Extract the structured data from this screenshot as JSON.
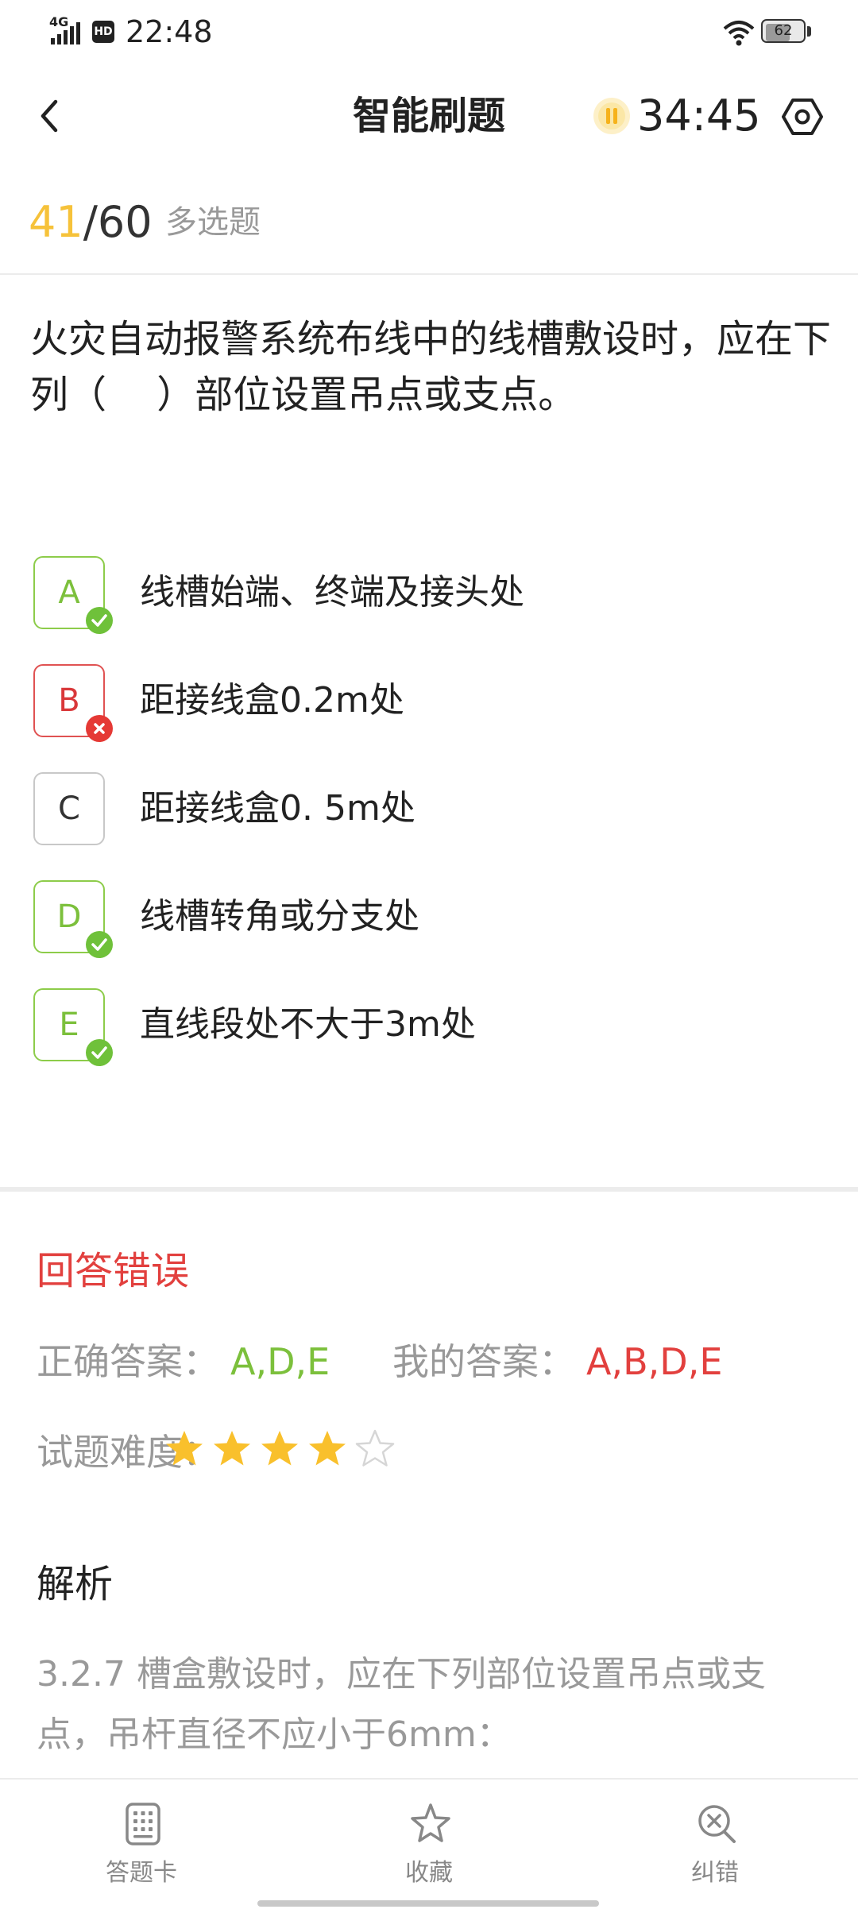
{
  "status_bar": {
    "network": "4G",
    "hd": "HD",
    "time": "22:48",
    "battery": "62"
  },
  "nav": {
    "title": "智能刷题",
    "timer": "34:45"
  },
  "progress": {
    "current": "41",
    "separator": "/",
    "total": "60",
    "type": "多选题"
  },
  "question": {
    "text": "火灾自动报警系统布线中的线槽敷设时，应在下列（　 ）部位设置吊点或支点。"
  },
  "options": [
    {
      "letter": "A",
      "text": "线槽始端、终端及接头处",
      "state": "correct"
    },
    {
      "letter": "B",
      "text": "距接线盒0.2m处",
      "state": "wrong"
    },
    {
      "letter": "C",
      "text": "距接线盒0. 5m处",
      "state": "none"
    },
    {
      "letter": "D",
      "text": "线槽转角或分支处",
      "state": "correct"
    },
    {
      "letter": "E",
      "text": "直线段处不大于3m处",
      "state": "correct"
    }
  ],
  "result": {
    "title": "回答错误",
    "correct_label": "正确答案：",
    "correct_value": "A,D,E",
    "my_label": "我的答案：",
    "my_value": "A,B,D,E",
    "difficulty_label": "试题难度：",
    "difficulty": 4,
    "difficulty_max": 5
  },
  "analysis": {
    "title": "解析",
    "text": "3.2.7 槽盒敷设时，应在下列部位设置吊点或支点，吊杆直径不应小于6mm："
  },
  "bottom_tabs": [
    {
      "label": "答题卡",
      "icon": "answer-card-icon"
    },
    {
      "label": "收藏",
      "icon": "star-outline-icon"
    },
    {
      "label": "纠错",
      "icon": "error-search-icon"
    }
  ],
  "colors": {
    "accent_yellow": "#f6c23a",
    "correct_green": "#7cc03c",
    "wrong_red": "#e2403e",
    "muted_gray": "#999999"
  }
}
